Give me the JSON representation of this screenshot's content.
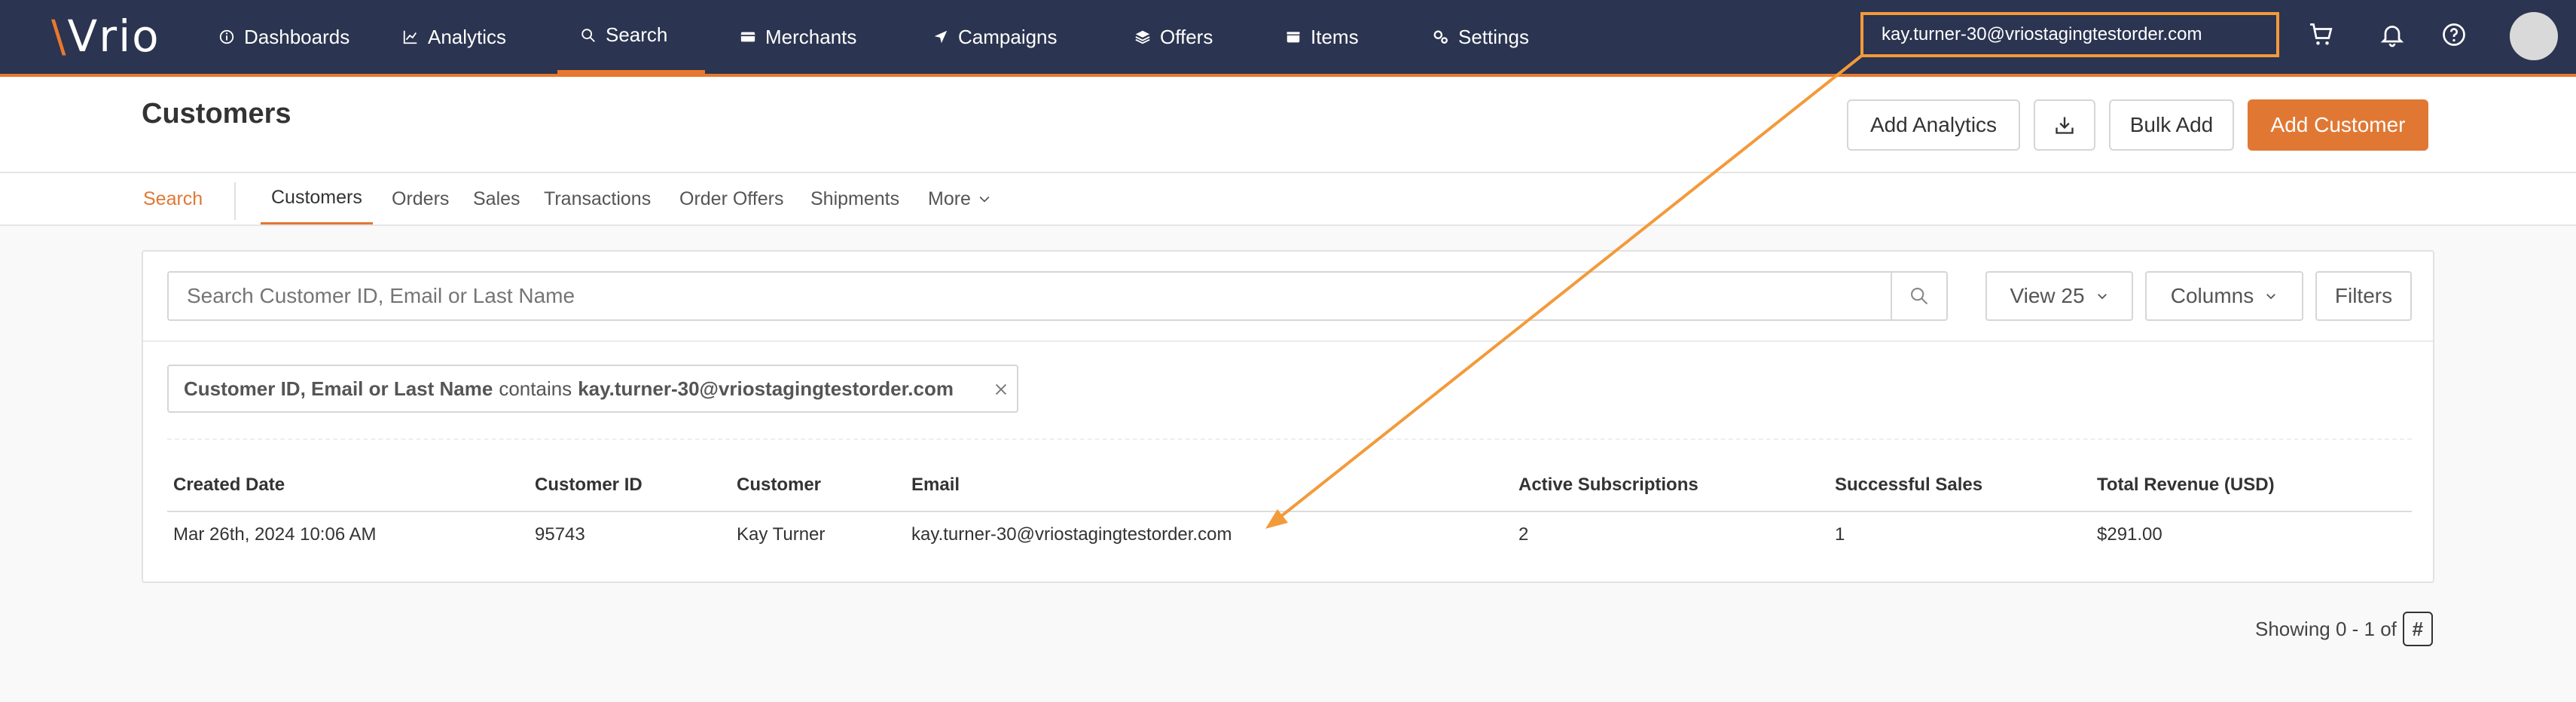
{
  "app": {
    "logo": "Vrio"
  },
  "nav": {
    "items": [
      {
        "label": "Dashboards",
        "icon": "info-icon"
      },
      {
        "label": "Analytics",
        "icon": "chart-icon"
      },
      {
        "label": "Search",
        "icon": "search-icon"
      },
      {
        "label": "Merchants",
        "icon": "card-icon"
      },
      {
        "label": "Campaigns",
        "icon": "send-icon"
      },
      {
        "label": "Offers",
        "icon": "layers-icon"
      },
      {
        "label": "Items",
        "icon": "box-icon"
      },
      {
        "label": "Settings",
        "icon": "gears-icon"
      }
    ],
    "active": "Search",
    "search_value": "kay.turner-30@vriostagingtestorder.com"
  },
  "header": {
    "title": "Customers",
    "buttons": {
      "add_analytics": "Add Analytics",
      "bulk_add": "Bulk Add",
      "add_customer": "Add Customer"
    }
  },
  "subtabs": {
    "search": "Search",
    "items": [
      "Customers",
      "Orders",
      "Sales",
      "Transactions",
      "Order Offers",
      "Shipments",
      "More"
    ],
    "active": "Customers"
  },
  "card": {
    "search_placeholder": "Search Customer ID, Email or Last Name",
    "view_label": "View 25",
    "columns_label": "Columns",
    "filters_label": "Filters",
    "filter_chip": {
      "field": "Customer ID, Email or Last Name",
      "operator": "contains",
      "value": "kay.turner-30@vriostagingtestorder.com"
    },
    "table": {
      "headers": [
        "Created Date",
        "Customer ID",
        "Customer",
        "Email",
        "Active Subscriptions",
        "Successful Sales",
        "Total Revenue (USD)"
      ],
      "rows": [
        [
          "Mar 26th, 2024 10:06 AM",
          "95743",
          "Kay Turner",
          "kay.turner-30@vriostagingtestorder.com",
          "2",
          "1",
          "$291.00"
        ]
      ]
    }
  },
  "footer": {
    "showing": "Showing 0 - 1 of",
    "total_symbol": "#"
  },
  "colors": {
    "nav_bg": "#2b3450",
    "accent": "#e07834",
    "highlight": "#f39a3a"
  }
}
